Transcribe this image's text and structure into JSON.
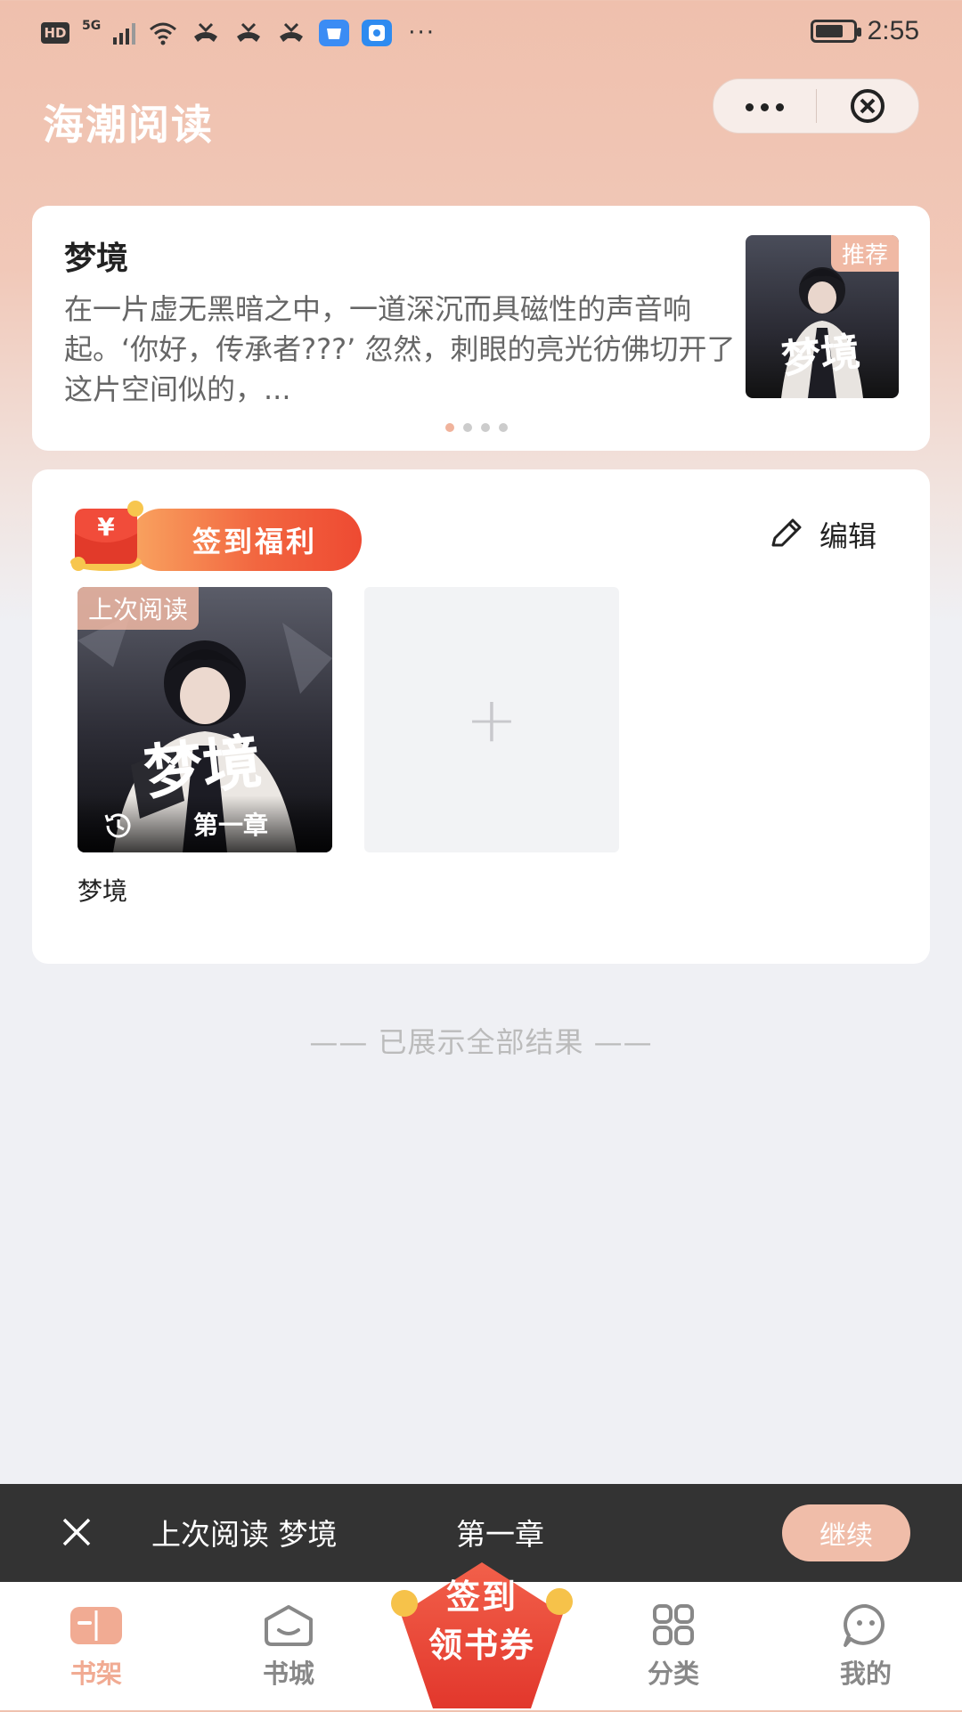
{
  "status_bar": {
    "hd": "HD",
    "signal_label": "5G",
    "time": "2:55"
  },
  "header": {
    "title": "海潮阅读",
    "capsule_more_icon": "more-dots-icon",
    "capsule_close_icon": "close-circle-icon"
  },
  "recommend": {
    "title": "梦境",
    "description": "在一片虚无黑暗之中，一道深沉而具磁性的声音响起。‘你好，传承者???’ 忽然，刺眼的亮光彷佛切开了这片空间似的，...",
    "badge": "推荐",
    "cover_title": "梦境",
    "pager_total": 4,
    "pager_active": 1
  },
  "shelf": {
    "signin_label": "签到福利",
    "redpack_symbol": "¥",
    "edit_label": "编辑",
    "books": [
      {
        "name": "梦境",
        "badge": "上次阅读",
        "chapter": "第一章",
        "cover_title": "梦境"
      }
    ],
    "add_symbol": "+"
  },
  "end_text": "—— 已展示全部结果 ——",
  "continue_bar": {
    "text": "上次阅读 梦境",
    "chapter": "第一章",
    "button": "继续"
  },
  "tabbar": {
    "tabs": [
      {
        "label": "书架",
        "icon": "bookshelf-icon",
        "active": true
      },
      {
        "label": "书城",
        "icon": "bookstore-icon",
        "active": false
      },
      {
        "label": "分类",
        "icon": "category-grid-icon",
        "active": false
      },
      {
        "label": "我的",
        "icon": "profile-face-icon",
        "active": false
      }
    ],
    "promo_line1": "签到",
    "promo_line2": "领书券"
  },
  "colors": {
    "header_bg": "#efc0ad",
    "accent": "#f0bda9",
    "active_tab": "#f1ab93",
    "continue_bar_bg": "#333333"
  }
}
